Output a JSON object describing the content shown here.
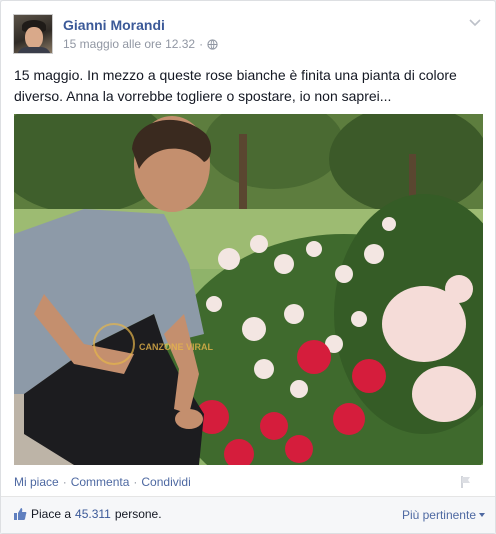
{
  "post": {
    "author": "Gianni Morandi",
    "timestamp": "15 maggio alle ore 12.32",
    "separator": "·",
    "privacy_icon": "globe-icon",
    "text": "15 maggio. In mezzo a queste rose bianche è finita una pianta di colore diverso. Anna la vorrebbe togliere o spostare, io non saprei...",
    "photo_watermark": "CANZONE VIRAL"
  },
  "actions": {
    "like": "Mi piace",
    "dot1": "·",
    "comment": "Commenta",
    "dot2": "·",
    "share": "Condividi"
  },
  "footer": {
    "likes_prefix": "Piace a",
    "likes_count": "45.311",
    "likes_suffix": "persone.",
    "sort_label": "Più pertinente"
  },
  "colors": {
    "link": "#3b5998",
    "muted": "#9197a3",
    "footer_bg": "#f6f7f9"
  }
}
